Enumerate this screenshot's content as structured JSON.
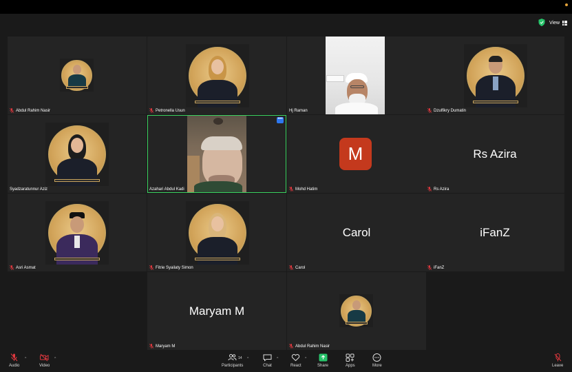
{
  "header": {
    "view_label": "View"
  },
  "tiles": [
    {
      "name": "Abdul Rahim Nasir",
      "display": "portrait"
    },
    {
      "name": "Petronella Usun",
      "display": "portrait"
    },
    {
      "name": "Hj Raman",
      "display": "video"
    },
    {
      "name": "Dzulfikry Dumatin",
      "display": "portrait"
    },
    {
      "name": "Syadzaratunnur Aziz",
      "display": "portrait"
    },
    {
      "name": "Azahari Abdul Kadi",
      "display": "video"
    },
    {
      "name": "Mohd Hatim",
      "display": "avatar",
      "avatar_letter": "M"
    },
    {
      "name": "Rs Azira",
      "display": "text",
      "big_name": "Rs Azira"
    },
    {
      "name": "Asri Asmat",
      "display": "portrait"
    },
    {
      "name": "Fitrie Syailaty Simon",
      "display": "portrait"
    },
    {
      "name": "Carol",
      "display": "text",
      "big_name": "Carol"
    },
    {
      "name": "iFanZ",
      "display": "text",
      "big_name": "iFanZ"
    },
    {
      "name": "Maryam M",
      "display": "text",
      "big_name": "Maryam M"
    },
    {
      "name": "Abdul Rahim Nasir",
      "display": "portrait"
    }
  ],
  "active_speaker": "Azahari Abdul Kadi",
  "active_tile_badge": "•••",
  "toolbar": {
    "audio": "Audio",
    "video": "Video",
    "participants": "Participants",
    "participants_count": "14",
    "chat": "Chat",
    "react": "React",
    "share": "Share",
    "apps": "Apps",
    "more": "More",
    "leave": "Leave"
  },
  "colors": {
    "active_speaker_border": "#3bd461",
    "avatar_bg": "#c4391d",
    "share_green": "#27c36a",
    "mic_muted": "#e0383e"
  }
}
